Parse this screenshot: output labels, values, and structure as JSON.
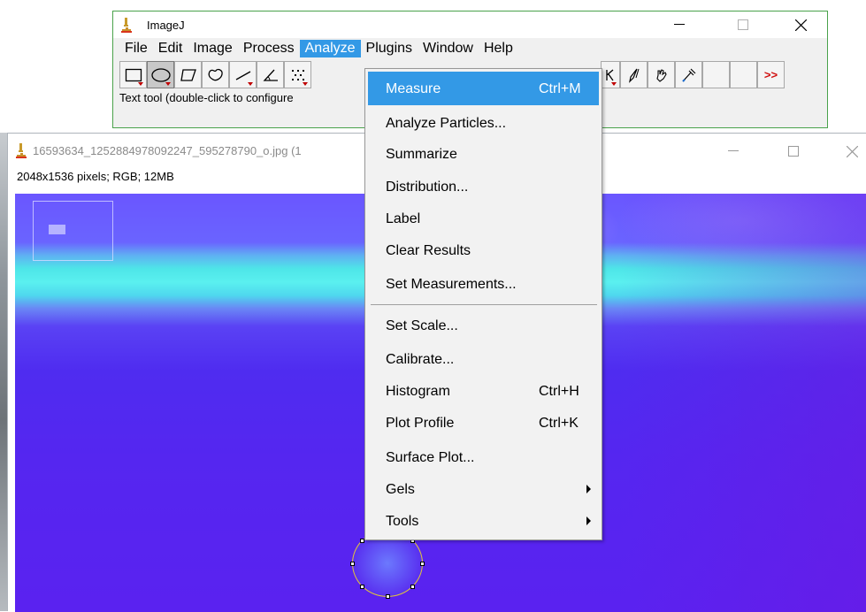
{
  "image_window": {
    "title": "16593634_1252884978092247_595278790_o.jpg (1",
    "info": "2048x1536 pixels; RGB; 12MB"
  },
  "imagej": {
    "title": "ImageJ",
    "menus": [
      "File",
      "Edit",
      "Image",
      "Process",
      "Analyze",
      "Plugins",
      "Window",
      "Help"
    ],
    "active_menu": "Analyze",
    "status": "Text tool (double-click to configure",
    "more_tools": ">>",
    "tool_icons": [
      "rectangle-tool-icon",
      "oval-tool-icon",
      "polygon-tool-icon",
      "freehand-tool-icon",
      "line-tool-icon",
      "angle-tool-icon",
      "point-tool-icon"
    ],
    "right_tool_icons": [
      "brush-tool-icon",
      "hand-tool-icon",
      "dropper-tool-icon"
    ]
  },
  "analyze_menu": {
    "items": [
      {
        "label": "Measure",
        "shortcut": "Ctrl+M",
        "highlighted": true
      },
      {
        "label": "Analyze Particles..."
      },
      {
        "label": "Summarize"
      },
      {
        "label": "Distribution..."
      },
      {
        "label": "Label"
      },
      {
        "label": "Clear Results"
      },
      {
        "label": "Set Measurements..."
      },
      {
        "label": "Set Scale..."
      },
      {
        "label": "Calibrate..."
      },
      {
        "label": "Histogram",
        "shortcut": "Ctrl+H"
      },
      {
        "label": "Plot Profile",
        "shortcut": "Ctrl+K"
      },
      {
        "label": "Surface Plot..."
      },
      {
        "label": "Gels",
        "submenu": true
      },
      {
        "label": "Tools",
        "submenu": true
      }
    ]
  },
  "colors": {
    "menu_highlight": "#3399e6",
    "active_window_border": "#4aa24b",
    "roi_color": "#e3c63a"
  }
}
